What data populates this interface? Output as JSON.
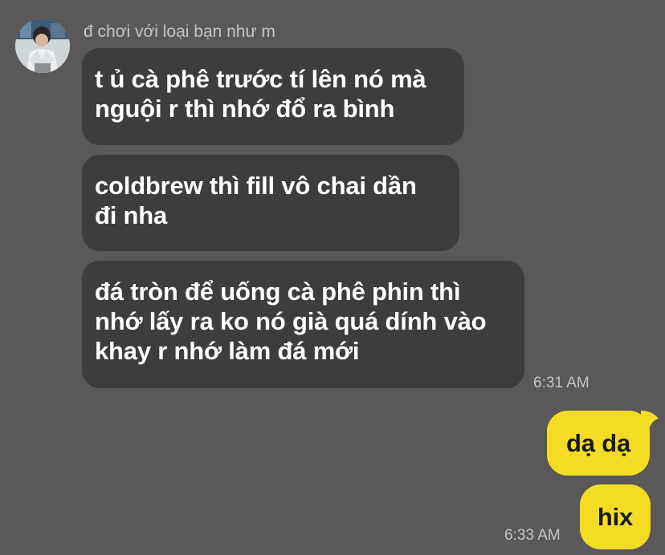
{
  "chat": {
    "sender_name": "đ chơi với loại bạn như m",
    "incoming": [
      {
        "lines": [
          "t ủ cà phê trước tí lên nó mà",
          "nguội r thì nhớ đổ ra bình"
        ]
      },
      {
        "lines": [
          "coldbrew thì fill vô chai dần",
          "đi nha"
        ]
      },
      {
        "lines": [
          "đá tròn để uống cà phê phin thì",
          "nhớ lấy ra ko nó già quá dính vào",
          "khay r nhớ làm đá mới"
        ]
      }
    ],
    "incoming_time": "6:31 AM",
    "outgoing": [
      {
        "text": "dạ dạ"
      },
      {
        "text": "hix"
      }
    ],
    "outgoing_time": "6:33 AM"
  },
  "colors": {
    "background": "#5a5859",
    "incoming_bubble": "#3d3c3e",
    "outgoing_bubble": "#f5dc24",
    "meta_text": "#c4c4c4"
  },
  "icons": {
    "avatar": "profile-photo"
  }
}
